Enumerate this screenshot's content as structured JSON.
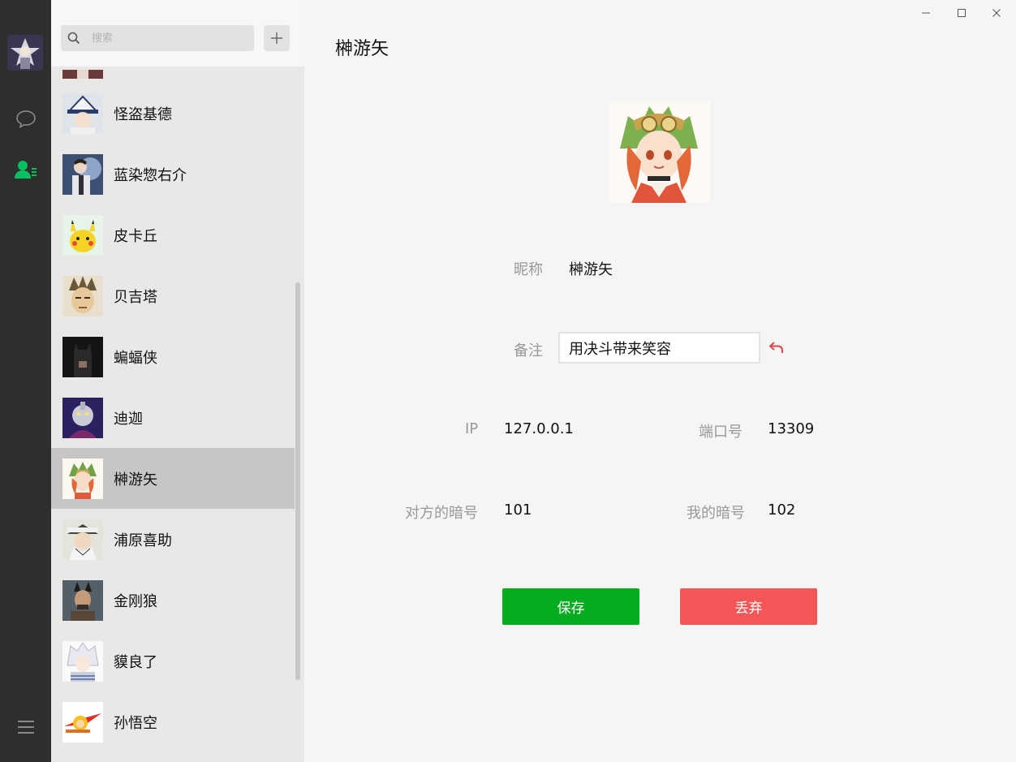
{
  "colors": {
    "accent_green": "#05ac1d",
    "danger_red": "#f35656",
    "rail": "#2e2e2e",
    "selected_row": "#c8c6c5"
  },
  "sidebar": {
    "icons": [
      "chat-bubble-icon",
      "contacts-icon",
      "menu-icon"
    ],
    "active": "contacts"
  },
  "search": {
    "placeholder": "搜索",
    "value": ""
  },
  "contacts": [
    {
      "name": "",
      "partial": true
    },
    {
      "name": "怪盗基德"
    },
    {
      "name": "蓝染惣右介"
    },
    {
      "name": "皮卡丘"
    },
    {
      "name": "贝吉塔"
    },
    {
      "name": "蝙蝠侠"
    },
    {
      "name": "迪迦"
    },
    {
      "name": "榊游矢",
      "selected": true
    },
    {
      "name": "浦原喜助"
    },
    {
      "name": "金刚狼"
    },
    {
      "name": "貘良了"
    },
    {
      "name": "孙悟空"
    }
  ],
  "detail": {
    "title": "榊游矢",
    "nickname_label": "昵称",
    "nickname": "榊游矢",
    "remark_label": "备注",
    "remark_value": "用决斗带来笑容",
    "ip_label": "IP",
    "ip": "127.0.0.1",
    "port_label": "端口号",
    "port": "13309",
    "their_code_label": "对方的暗号",
    "their_code": "101",
    "my_code_label": "我的暗号",
    "my_code": "102",
    "save_label": "保存",
    "discard_label": "丢弃"
  }
}
